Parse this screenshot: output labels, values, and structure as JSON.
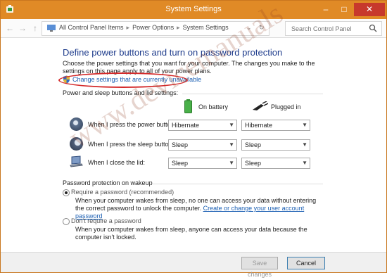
{
  "window": {
    "title": "System Settings"
  },
  "address": {
    "crumbs": [
      "All Control Panel Items",
      "Power Options",
      "System Settings"
    ],
    "search_placeholder": "Search Control Panel"
  },
  "page": {
    "heading": "Define power buttons and turn on password protection",
    "description": "Choose the power settings that you want for your computer. The changes you make to the settings on this page apply to all of your power plans.",
    "change_link": "Change settings that are currently unavailable"
  },
  "power_section": {
    "heading": "Power and sleep buttons and lid settings:",
    "columns": {
      "battery": "On battery",
      "plugged": "Plugged in"
    },
    "rows": [
      {
        "label": "When I press the power button:",
        "battery": "Hibernate",
        "plugged": "Hibernate"
      },
      {
        "label": "When I press the sleep button:",
        "battery": "Sleep",
        "plugged": "Sleep"
      },
      {
        "label": "When I close the lid:",
        "battery": "Sleep",
        "plugged": "Sleep"
      }
    ]
  },
  "password_section": {
    "heading": "Password protection on wakeup",
    "require": {
      "label": "Require a password (recommended)",
      "text": "When your computer wakes from sleep, no one can access your data without entering the correct password to unlock the computer.",
      "link": "Create or change your user account password",
      "selected": true
    },
    "dont_require": {
      "label": "Don't require a password",
      "text": "When your computer wakes from sleep, anyone can access your data because the computer isn't locked.",
      "selected": false
    }
  },
  "footer": {
    "save_label": "Save changes",
    "cancel_label": "Cancel"
  },
  "watermark": "www.devicemanuals"
}
